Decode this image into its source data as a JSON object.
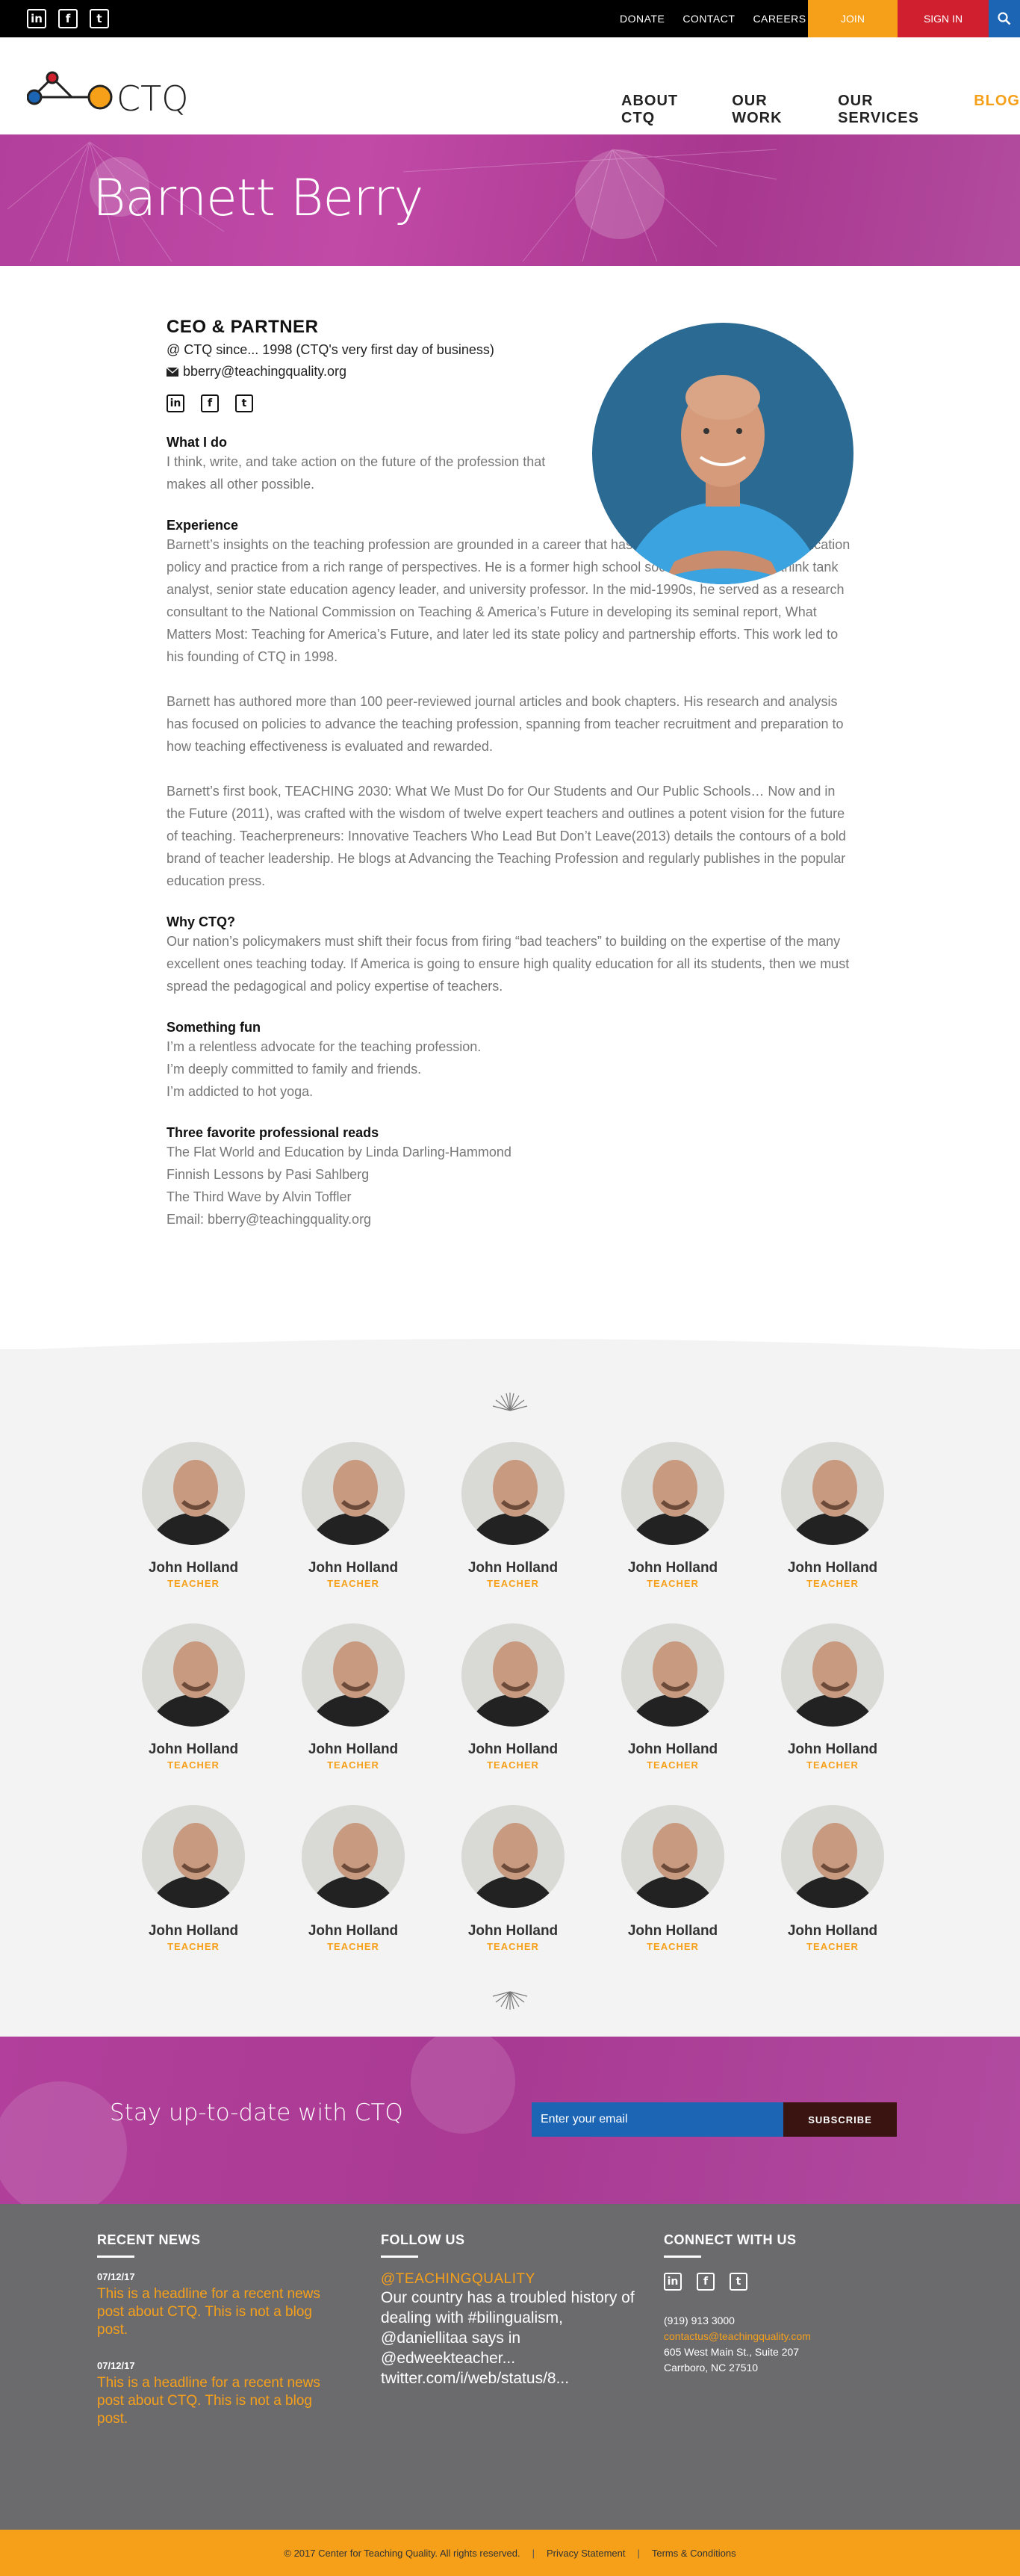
{
  "topbar": {
    "social": [
      "in",
      "f",
      "t"
    ],
    "links": [
      "DONATE",
      "CONTACT",
      "CAREERS"
    ],
    "join": "JOIN",
    "signin": "SIGN IN"
  },
  "header": {
    "logo_text": "CTQ",
    "nav": [
      "ABOUT CTQ",
      "OUR WORK",
      "OUR SERVICES",
      "BLOG"
    ]
  },
  "banner": {
    "title": "Barnett Berry"
  },
  "profile": {
    "role": "CEO & PARTNER",
    "since": "@ CTQ since... 1998 (CTQ's very first day of business)",
    "email": "bberry@teachingquality.org",
    "sections": [
      {
        "heading": "What I do",
        "paras": [
          "I think, write, and take action on the future of the profession that makes all other possible."
        ]
      },
      {
        "heading": "Experience",
        "paras": [
          "Barnett’s insights on the teaching profession are grounded in a career that has positioned him to analyze education policy and practice from a rich range of perspectives. He is a former high school social studies teacher, think tank analyst, senior state education agency leader, and university professor. In the mid-1990s, he served as a research consultant to the National Commission on Teaching & America’s Future in developing its seminal report, What Matters Most: Teaching for America’s Future, and later led its state policy and partnership efforts. This work led to his founding of CTQ in 1998.",
          "Barnett has authored more than 100 peer-reviewed journal articles and book chapters. His research and analysis has focused on policies to advance the teaching profession, spanning from teacher recruitment and preparation to how teaching effectiveness is evaluated and rewarded.",
          "Barnett’s first book, TEACHING 2030: What We Must Do for Our Students and Our Public Schools… Now and in the Future (2011), was crafted with the wisdom of twelve expert teachers and outlines a potent vision for the future of teaching. Teacherpreneurs: Innovative Teachers Who Lead But Don’t Leave(2013) details the contours of a bold brand of teacher leadership. He blogs at Advancing the Teaching Profession and regularly publishes in the popular education press."
        ]
      },
      {
        "heading": "Why CTQ?",
        "paras": [
          "Our nation’s policymakers must shift their focus from firing “bad teachers” to building on the expertise of the many excellent ones teaching today. If America is going to ensure high quality education for all its students, then we must spread the pedagogical and policy expertise of teachers."
        ]
      },
      {
        "heading": "Something fun",
        "lines": [
          "I’m a relentless advocate for the teaching profession.",
          "I’m deeply committed to family and friends.",
          "I’m addicted to hot yoga."
        ]
      },
      {
        "heading": "Three favorite professional reads",
        "lines": [
          "The Flat World and Education by Linda Darling-Hammond",
          "Finnish Lessons by Pasi Sahlberg",
          "The Third Wave by Alvin Toffler",
          "Email: bberry@teachingquality.org"
        ]
      }
    ]
  },
  "team": {
    "members": [
      {
        "name": "John Holland",
        "role": "TEACHER"
      },
      {
        "name": "John Holland",
        "role": "TEACHER"
      },
      {
        "name": "John Holland",
        "role": "TEACHER"
      },
      {
        "name": "John Holland",
        "role": "TEACHER"
      },
      {
        "name": "John Holland",
        "role": "TEACHER"
      },
      {
        "name": "John Holland",
        "role": "TEACHER"
      },
      {
        "name": "John Holland",
        "role": "TEACHER"
      },
      {
        "name": "John Holland",
        "role": "TEACHER"
      },
      {
        "name": "John Holland",
        "role": "TEACHER"
      },
      {
        "name": "John Holland",
        "role": "TEACHER"
      },
      {
        "name": "John Holland",
        "role": "TEACHER"
      },
      {
        "name": "John Holland",
        "role": "TEACHER"
      },
      {
        "name": "John Holland",
        "role": "TEACHER"
      },
      {
        "name": "John Holland",
        "role": "TEACHER"
      },
      {
        "name": "John Holland",
        "role": "TEACHER"
      }
    ]
  },
  "subscribe": {
    "heading": "Stay up-to-date with CTQ",
    "placeholder": "Enter your email",
    "button": "SUBSCRIBE"
  },
  "footer": {
    "recent": {
      "heading": "RECENT NEWS",
      "items": [
        {
          "date": "07/12/17",
          "headline": "This is a headline for a recent news post about CTQ. This is not a blog post."
        },
        {
          "date": "07/12/17",
          "headline": "This is a headline for a recent news post about CTQ. This is not a blog post."
        }
      ]
    },
    "follow": {
      "heading": "FOLLOW US",
      "handle": "@TEACHINGQUALITY",
      "tweet": "Our country has a troubled history of dealing with #bilingualism, @daniellitaa says in @edweekteacher... twitter.com/i/web/status/8..."
    },
    "connect": {
      "heading": "CONNECT WITH US",
      "phone": "(919) 913 3000",
      "email": "contactus@teachingquality.com",
      "address1": "605 West Main St., Suite 207",
      "address2": "Carrboro, NC 27510"
    },
    "bottom": {
      "copyright": "© 2017 Center for Teaching Quality. All rights reserved.",
      "privacy": "Privacy Statement",
      "terms": "Terms & Conditions",
      "sep": "|"
    }
  },
  "colors": {
    "accent_orange": "#f6a01a",
    "brand_magenta": "#b13f9b",
    "signin_red": "#d0202f",
    "search_blue": "#1c64b4"
  },
  "icons": [
    "linkedin-icon",
    "facebook-icon",
    "twitter-icon",
    "search-icon",
    "envelope-icon",
    "sunburst-icon"
  ]
}
